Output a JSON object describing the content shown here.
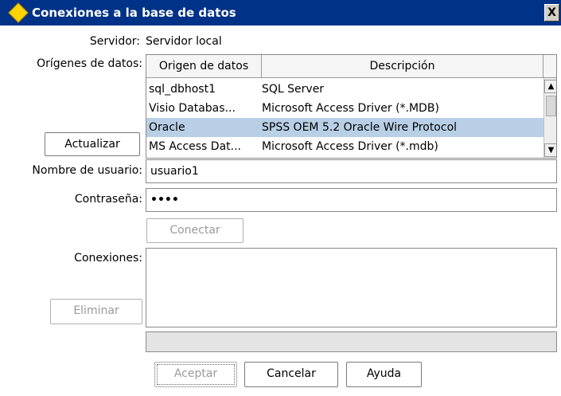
{
  "window": {
    "title": "Conexiones a la base de datos",
    "close_glyph": "X"
  },
  "server": {
    "label": "Servidor:",
    "value": "Servidor local"
  },
  "datasources": {
    "label": "Orígenes de datos:",
    "columns": [
      "Origen de datos",
      "Descripción"
    ],
    "rows": [
      {
        "name": "sql_dbhost1",
        "description": "SQL Server",
        "selected": false
      },
      {
        "name": "Visio Databas...",
        "description": "Microsoft Access Driver (*.MDB)",
        "selected": false
      },
      {
        "name": "Oracle",
        "description": "SPSS OEM 5.2 Oracle Wire Protocol",
        "selected": true
      },
      {
        "name": "MS Access Dat...",
        "description": "Microsoft Access Driver (*.mdb)",
        "selected": false
      }
    ],
    "refresh_label": "Actualizar"
  },
  "username": {
    "label": "Nombre de usuario:",
    "value": "usuario1"
  },
  "password": {
    "label": "Contraseña:",
    "value": "••••"
  },
  "connect_label": "Conectar",
  "connections": {
    "label": "Conexiones:",
    "remove_label": "Eliminar"
  },
  "footer": {
    "ok_label": "Aceptar",
    "cancel_label": "Cancelar",
    "help_label": "Ayuda"
  },
  "icons": {
    "title": "diamond-icon",
    "close": "close-icon",
    "scroll_up": "scroll-up-icon",
    "scroll_down": "scroll-down-icon"
  },
  "colors": {
    "titlebar": "#003287",
    "selection": "#b8cfe6",
    "title_icon": "#ffd400"
  }
}
